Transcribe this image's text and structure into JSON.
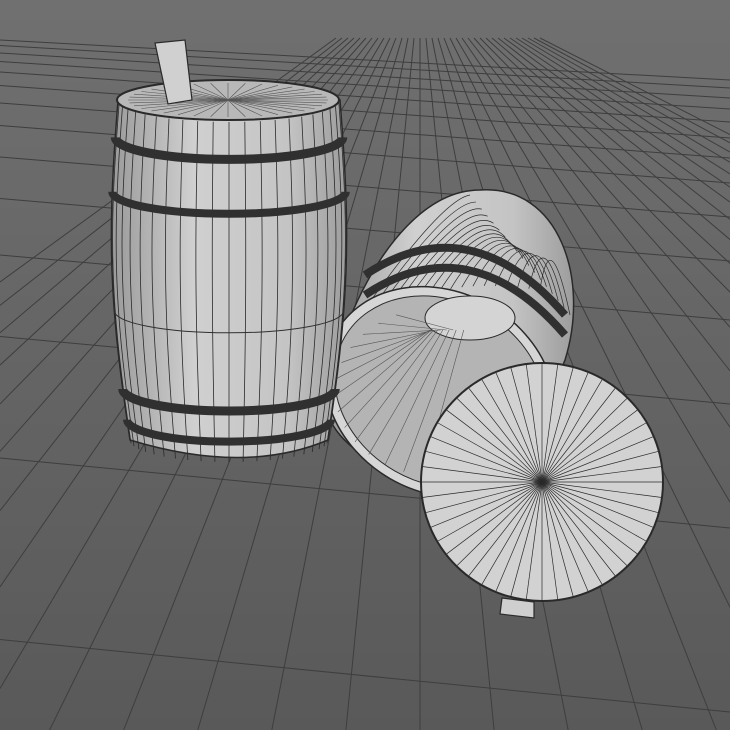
{
  "viewport": {
    "colors": {
      "background_top": "#707070",
      "background_bottom": "#595959",
      "grid_line": "#3e3e3e",
      "wood_fill": "#c8c8c8",
      "wood_shade": "#a9a9a9",
      "wire": "#2a2a2a",
      "band": "#303030",
      "interior": "#b4b4b4",
      "lid_fill": "#d2d2d2"
    },
    "objects": [
      "standing-barrel",
      "lying-barrel",
      "barrel-lid"
    ]
  }
}
